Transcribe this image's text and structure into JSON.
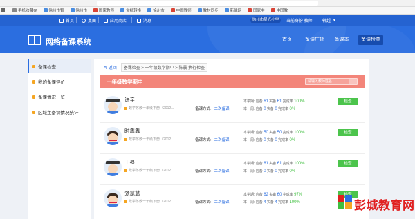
{
  "bookmarks": [
    {
      "icon": "apps-icon",
      "label": ""
    },
    {
      "icon": "bookmark-icon",
      "label": "手机收藏夹"
    },
    {
      "icon": "site-icon",
      "label": "徐州市智"
    },
    {
      "icon": "site-icon",
      "label": "徐州市"
    },
    {
      "icon": "site-icon",
      "label": "国家教师"
    },
    {
      "icon": "site-icon",
      "label": "文档转换"
    },
    {
      "icon": "site-icon",
      "label": "徐州市"
    },
    {
      "icon": "site-icon",
      "label": "中国教师"
    },
    {
      "icon": "site-icon",
      "label": "教材同步"
    },
    {
      "icon": "site-icon",
      "label": "新能网"
    },
    {
      "icon": "site-icon",
      "label": "国家中"
    },
    {
      "icon": "site-icon",
      "label": "中国教"
    }
  ],
  "topnav": {
    "home": "首页",
    "desktop": "桌面",
    "app_store": "应用商店",
    "messages": "消息",
    "school": "徐州市星光小学",
    "role": "当前身份 教师",
    "user": "韩超"
  },
  "brand": "网络备课系统",
  "main_nav": [
    "首页",
    "备课广场",
    "备课本",
    "备课检查"
  ],
  "sidebar": [
    "备课检查",
    "我的备课评价",
    "备课情况一览",
    "区域主备课情况统计"
  ],
  "breadcrumb": {
    "back": "返回",
    "items": [
      "备课检查",
      "一年级数学期中",
      "陈晨 执行检查"
    ]
  },
  "banner": {
    "title": "一年级数学期中",
    "search_placeholder": "请输入教师姓名"
  },
  "stat_labels": {
    "semester": "本学期:",
    "week": "本　周:",
    "planned": "应备",
    "actual": "实备",
    "rate": "完成率"
  },
  "method_label": "备课方式:",
  "check_label": "检查",
  "teachers": [
    {
      "name": "许辛",
      "book": "数学苏教一年级下册（2012...",
      "method": "二次备课",
      "avatar": "male",
      "sem_planned": "61",
      "sem_actual": "61",
      "sem_rate": "100%",
      "wk_planned": "0",
      "wk_actual": "0",
      "wk_rate": "0%"
    },
    {
      "name": "时鑫鑫",
      "book": "数学苏教一年级下册（2012...",
      "method": "二次备课",
      "avatar": "female",
      "sem_planned": "50",
      "sem_actual": "50",
      "sem_rate": "100%",
      "wk_planned": "0",
      "wk_actual": "0",
      "wk_rate": "0%"
    },
    {
      "name": "王易",
      "book": "数学苏教一年级下册（2012...",
      "method": "二次备课",
      "avatar": "male",
      "sem_planned": "61",
      "sem_actual": "61",
      "sem_rate": "100%",
      "wk_planned": "0",
      "wk_actual": "0",
      "wk_rate": "0%"
    },
    {
      "name": "张慧慧",
      "book": "数学苏教一年级下册（2012...",
      "method": "二次备课",
      "avatar": "female",
      "sem_planned": "62",
      "sem_actual": "60",
      "sem_rate": "97%",
      "wk_planned": "4",
      "wk_actual": "4",
      "wk_rate": "100%"
    }
  ],
  "watermark": "彭城教育网",
  "colors": {
    "primary": "#2b6ee0",
    "banner": "#f3857a",
    "success": "#4cc44c",
    "watermark": "#e02020"
  }
}
